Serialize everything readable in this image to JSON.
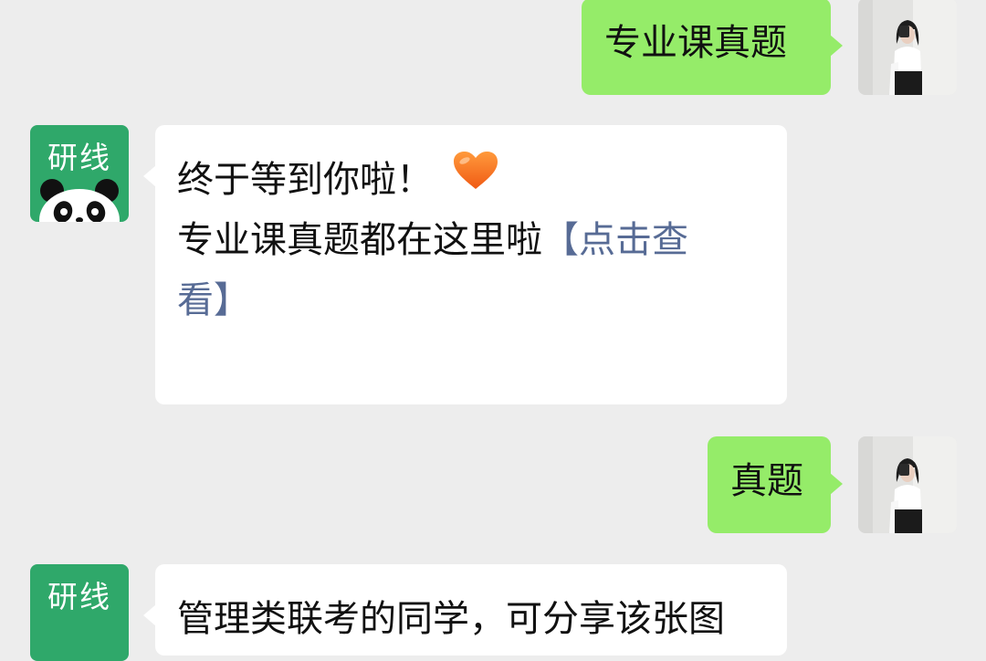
{
  "colors": {
    "background": "#ededed",
    "sent_bubble": "#95ec69",
    "received_bubble": "#ffffff",
    "link": "#576b95",
    "bot_avatar": "#2fa86a"
  },
  "bot": {
    "avatar_text": "研线",
    "avatar_icon": "panda-icon"
  },
  "messages": [
    {
      "direction": "sent",
      "text": "专业课真题"
    },
    {
      "direction": "received",
      "line1": "终于等到你啦！",
      "emoji": "orange-heart-icon",
      "line2_text": "专业课真题都在这里啦",
      "line2_link": "【点击查",
      "line3_link": "看】"
    },
    {
      "direction": "sent",
      "text": "真题"
    },
    {
      "direction": "received",
      "text": "管理类联考的同学，可分享该张图"
    }
  ]
}
